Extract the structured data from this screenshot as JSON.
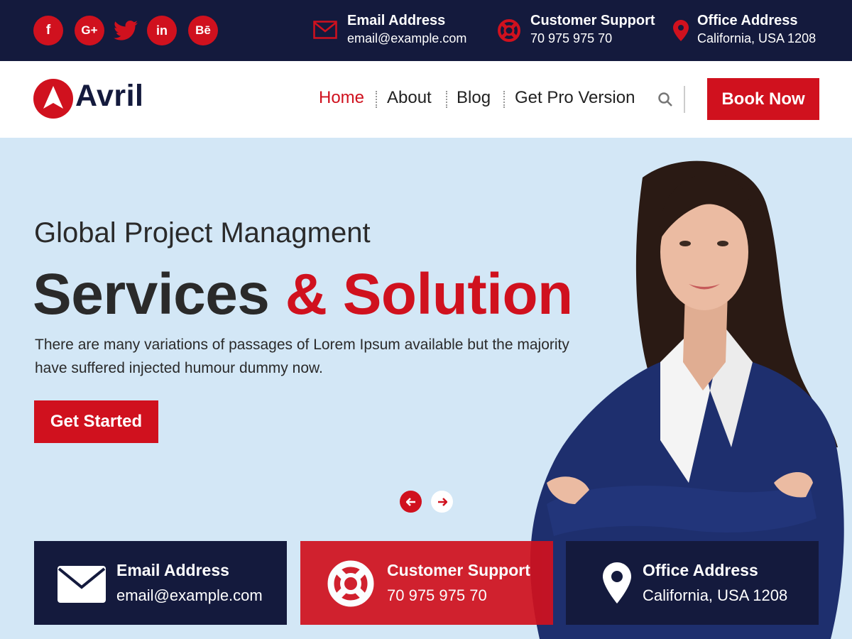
{
  "social": [
    {
      "icon": "facebook-icon",
      "glyph": "f"
    },
    {
      "icon": "google-plus-icon",
      "glyph": "G+"
    },
    {
      "icon": "twitter-icon",
      "glyph": ""
    },
    {
      "icon": "linkedin-icon",
      "glyph": "in"
    },
    {
      "icon": "behance-icon",
      "glyph": "Bē"
    }
  ],
  "topbar": {
    "email": {
      "title": "Email Address",
      "value": "email@example.com",
      "icon": "envelope-icon"
    },
    "support": {
      "title": "Customer Support",
      "value": "70 975 975 70",
      "icon": "lifebuoy-icon"
    },
    "office": {
      "title": "Office Address",
      "value": "California, USA 1208",
      "icon": "map-pin-icon"
    }
  },
  "brand": {
    "name": "Avril"
  },
  "nav": {
    "items": [
      {
        "label": "Home",
        "active": true
      },
      {
        "label": "About",
        "active": false
      },
      {
        "label": "Blog",
        "active": false
      },
      {
        "label": "Get Pro Version",
        "active": false
      }
    ],
    "book_label": "Book Now"
  },
  "hero": {
    "subtitle": "Global Project Managment",
    "headline_dark": "Services",
    "headline_red": "& Solution",
    "description": "There are many variations of passages of Lorem Ipsum available but the majority have suffered injected humour dummy now.",
    "cta_label": "Get Started"
  },
  "cards": [
    {
      "title": "Email Address",
      "value": "email@example.com",
      "icon": "envelope-icon"
    },
    {
      "title": "Customer Support",
      "value": "70 975 975 70",
      "icon": "lifebuoy-icon"
    },
    {
      "title": "Office Address",
      "value": "California, USA 1208",
      "icon": "map-pin-icon"
    }
  ],
  "colors": {
    "primary": "#d0111e",
    "navy": "#141a3d",
    "hero_bg": "#d3e7f6"
  }
}
